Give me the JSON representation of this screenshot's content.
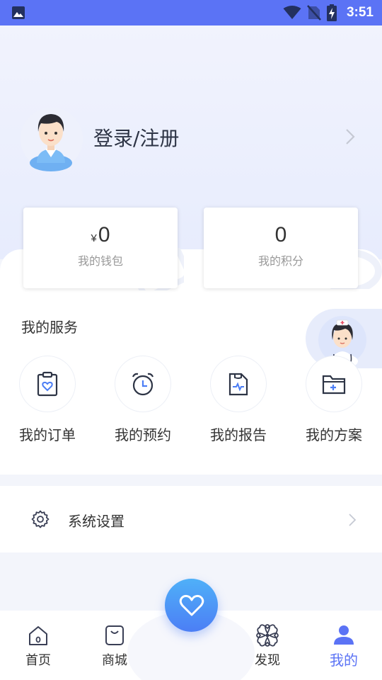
{
  "status_bar": {
    "time": "3:51",
    "icons": [
      "gallery-icon",
      "wifi-icon",
      "no-sim-icon",
      "battery-charging-icon"
    ]
  },
  "profile": {
    "login_label": "登录/注册",
    "avatar_icon": "user-avatar-icon",
    "arrow_icon": "chevron-right-icon"
  },
  "wallet": {
    "currency": "¥",
    "amount": "0",
    "label": "我的钱包"
  },
  "points": {
    "amount": "0",
    "label": "我的积分"
  },
  "services": {
    "title": "我的服务",
    "items": [
      {
        "label": "我的订单",
        "icon": "clipboard-heart-icon"
      },
      {
        "label": "我的预约",
        "icon": "alarm-clock-icon"
      },
      {
        "label": "我的报告",
        "icon": "report-pulse-icon"
      },
      {
        "label": "我的方案",
        "icon": "folder-plus-icon"
      }
    ]
  },
  "settings": {
    "label": "系统设置",
    "icon": "gear-icon"
  },
  "tab_bar": {
    "items": [
      {
        "label": "首页",
        "icon": "home-icon"
      },
      {
        "label": "商城",
        "icon": "shopping-bag-icon"
      },
      {
        "label": "发现",
        "icon": "clover-icon"
      },
      {
        "label": "我的",
        "icon": "person-icon",
        "active": true
      }
    ],
    "center_icon": "heart-icon"
  },
  "colors": {
    "accent": "#5b73f5",
    "status_bar": "#5b73f5",
    "fab_top": "#4fb0f8",
    "fab_bottom": "#4c7ef5"
  }
}
